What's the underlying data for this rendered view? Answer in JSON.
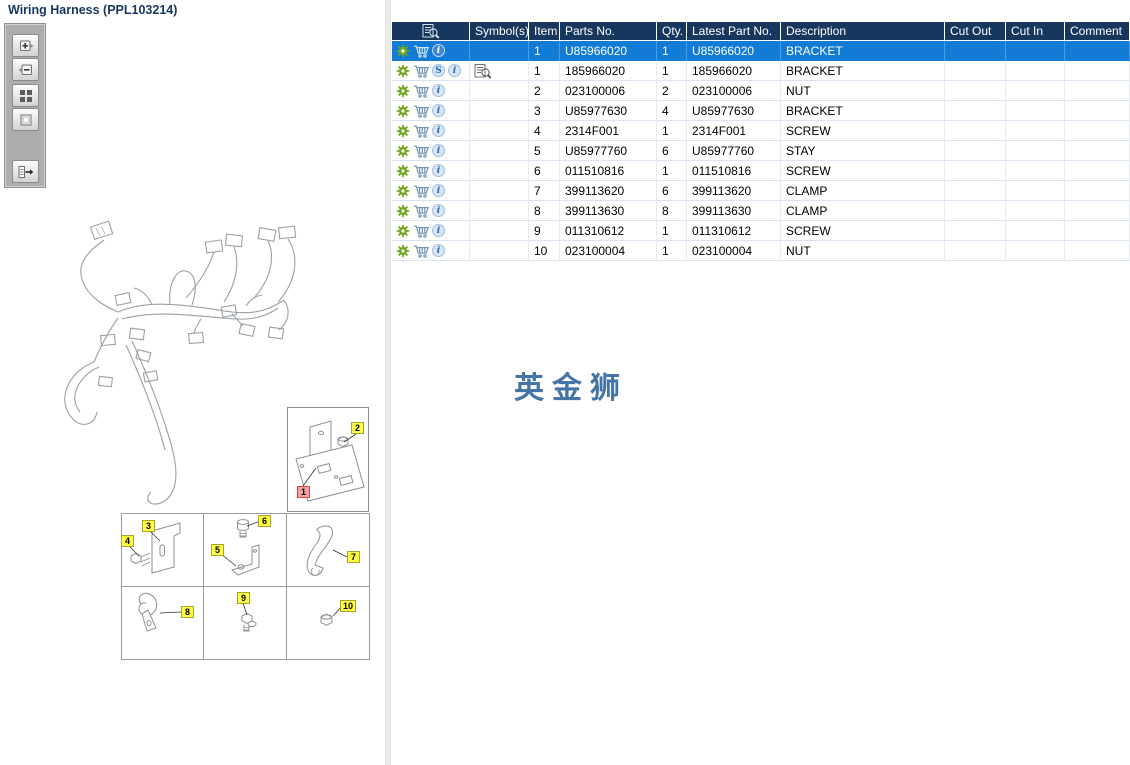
{
  "window": {
    "title": "Wiring Harness (PPL103214)"
  },
  "watermark": "英金狮",
  "colors": {
    "header_bg": "#17375e",
    "selected_row": "#127bd6",
    "gear_green": "#6fa81f",
    "cart_blue": "#6e93b4",
    "watermark_blue": "#4574a6",
    "callout_yellow": "#ffff42",
    "callout_red": "#f7a09f"
  },
  "icons": {
    "info_glyph": "i",
    "s_glyph": "S",
    "header_icon": "view-illustration-icon",
    "row_icons": [
      "gear-icon",
      "cart-icon",
      "info-icon"
    ]
  },
  "toolbar": {
    "buttons": [
      "zoom-in",
      "zoom-out",
      "tile-view",
      "fit-view",
      "toggle-panel"
    ]
  },
  "table": {
    "columns": [
      "",
      "Symbol(s)",
      "Item",
      "Parts No.",
      "Qty.",
      "Latest Part No.",
      "Description",
      "Cut Out",
      "Cut In",
      "Comment"
    ],
    "rows": [
      {
        "selected": true,
        "s_badge": false,
        "symbol_icon": false,
        "item": "1",
        "parts_no": "U85966020",
        "qty": "1",
        "latest_part_no": "U85966020",
        "description": "BRACKET",
        "cut_out": "",
        "cut_in": "",
        "comment": ""
      },
      {
        "selected": false,
        "s_badge": true,
        "symbol_icon": true,
        "item": "1",
        "parts_no": "185966020",
        "qty": "1",
        "latest_part_no": "185966020",
        "description": "BRACKET",
        "cut_out": "",
        "cut_in": "",
        "comment": ""
      },
      {
        "selected": false,
        "s_badge": false,
        "symbol_icon": false,
        "item": "2",
        "parts_no": "023100006",
        "qty": "2",
        "latest_part_no": "023100006",
        "description": "NUT",
        "cut_out": "",
        "cut_in": "",
        "comment": ""
      },
      {
        "selected": false,
        "s_badge": false,
        "symbol_icon": false,
        "item": "3",
        "parts_no": "U85977630",
        "qty": "4",
        "latest_part_no": "U85977630",
        "description": "BRACKET",
        "cut_out": "",
        "cut_in": "",
        "comment": ""
      },
      {
        "selected": false,
        "s_badge": false,
        "symbol_icon": false,
        "item": "4",
        "parts_no": "2314F001",
        "qty": "1",
        "latest_part_no": "2314F001",
        "description": "SCREW",
        "cut_out": "",
        "cut_in": "",
        "comment": ""
      },
      {
        "selected": false,
        "s_badge": false,
        "symbol_icon": false,
        "item": "5",
        "parts_no": "U85977760",
        "qty": "6",
        "latest_part_no": "U85977760",
        "description": "STAY",
        "cut_out": "",
        "cut_in": "",
        "comment": ""
      },
      {
        "selected": false,
        "s_badge": false,
        "symbol_icon": false,
        "item": "6",
        "parts_no": "011510816",
        "qty": "1",
        "latest_part_no": "011510816",
        "description": "SCREW",
        "cut_out": "",
        "cut_in": "",
        "comment": ""
      },
      {
        "selected": false,
        "s_badge": false,
        "symbol_icon": false,
        "item": "7",
        "parts_no": "399113620",
        "qty": "6",
        "latest_part_no": "399113620",
        "description": "CLAMP",
        "cut_out": "",
        "cut_in": "",
        "comment": ""
      },
      {
        "selected": false,
        "s_badge": false,
        "symbol_icon": false,
        "item": "8",
        "parts_no": "399113630",
        "qty": "8",
        "latest_part_no": "399113630",
        "description": "CLAMP",
        "cut_out": "",
        "cut_in": "",
        "comment": ""
      },
      {
        "selected": false,
        "s_badge": false,
        "symbol_icon": false,
        "item": "9",
        "parts_no": "011310612",
        "qty": "1",
        "latest_part_no": "011310612",
        "description": "SCREW",
        "cut_out": "",
        "cut_in": "",
        "comment": ""
      },
      {
        "selected": false,
        "s_badge": false,
        "symbol_icon": false,
        "item": "10",
        "parts_no": "023100004",
        "qty": "1",
        "latest_part_no": "023100004",
        "description": "NUT",
        "cut_out": "",
        "cut_in": "",
        "comment": ""
      }
    ]
  },
  "diagram": {
    "callouts": {
      "n1": "1",
      "n2": "2",
      "n3": "3",
      "n4": "4",
      "n5": "5",
      "n6": "6",
      "n7": "7",
      "n8": "8",
      "n9": "9",
      "n10": "10"
    }
  }
}
